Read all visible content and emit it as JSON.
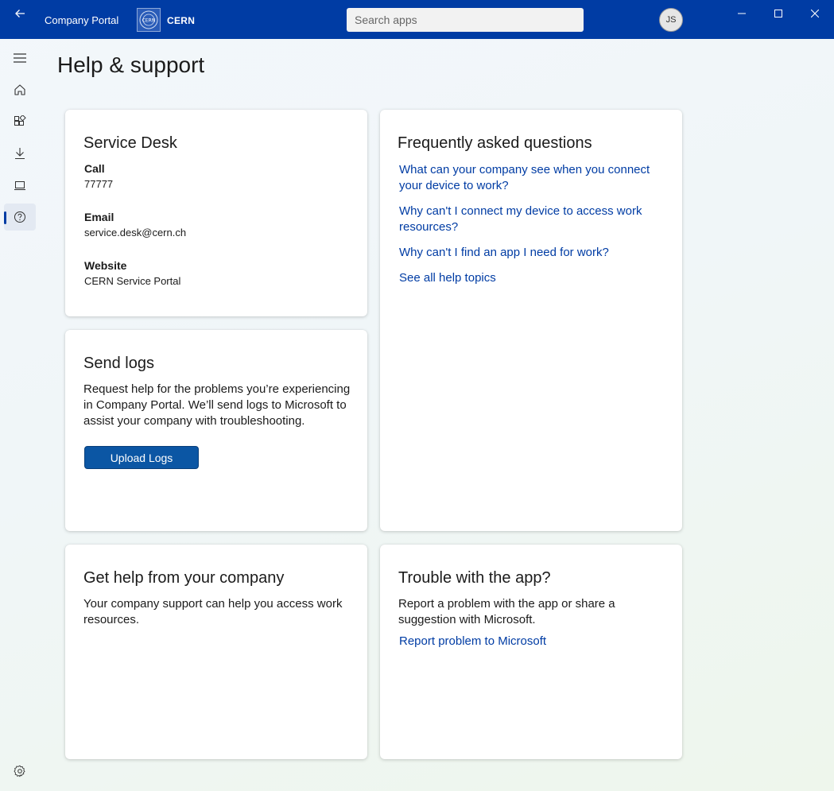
{
  "app": {
    "title": "Company Portal",
    "org_name": "CERN",
    "logo_text": "CERN",
    "avatar_initials": "JS",
    "accent_color": "#003ca4"
  },
  "search": {
    "placeholder": "Search apps",
    "value": ""
  },
  "sidebar": {
    "items": [
      {
        "name": "menu",
        "icon": "hamburger-icon"
      },
      {
        "name": "home",
        "icon": "home-icon"
      },
      {
        "name": "apps",
        "icon": "apps-icon"
      },
      {
        "name": "downloads",
        "icon": "download-icon"
      },
      {
        "name": "devices",
        "icon": "laptop-icon"
      },
      {
        "name": "help",
        "icon": "help-icon",
        "active": true
      }
    ],
    "settings_icon": "gear-icon"
  },
  "page": {
    "title": "Help & support"
  },
  "service_desk": {
    "title": "Service Desk",
    "call_label": "Call",
    "call_value": "77777",
    "email_label": "Email",
    "email_value": "service.desk@cern.ch",
    "website_label": "Website",
    "website_value": "CERN Service Portal"
  },
  "send_logs": {
    "title": "Send logs",
    "description": "Request help for the problems you’re experiencing in Company Portal. We’ll send logs to Microsoft to assist your company with troubleshooting.",
    "button_label": "Upload Logs"
  },
  "faq": {
    "title": "Frequently asked questions",
    "links": [
      "What can your company see when you connect your device to work?",
      "Why can't I connect my device to access work resources?",
      "Why can't I find an app I need for work?",
      "See all help topics"
    ]
  },
  "company_help": {
    "title": "Get help from your company",
    "description": "Your company support can help you access work resources."
  },
  "trouble": {
    "title": "Trouble with the app?",
    "description": "Report a problem with the app or share a suggestion with Microsoft.",
    "link": "Report problem to Microsoft"
  }
}
